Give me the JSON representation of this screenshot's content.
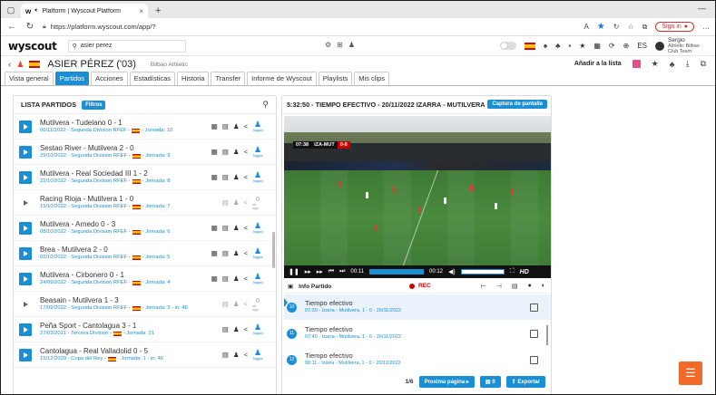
{
  "browser": {
    "tab_favicon": "w",
    "tab_title": "Platform | Wyscout Platform",
    "tab_close": "×",
    "new_tab": "+",
    "url": "https://platform.wyscout.com/app/?",
    "sign_in": "Sign in",
    "minimize": "—"
  },
  "app": {
    "logo": "wyscout",
    "search_value": "asier perez",
    "language": "ES",
    "user_name": "Sergio",
    "user_detail": "Athletic Bilbao Club Team"
  },
  "player": {
    "name": "ASIER PÉREZ ('03)",
    "club": "Bilbao Athletic",
    "add_to_list": "Añadir a la lista"
  },
  "tabs": [
    {
      "label": "Vista general",
      "active": false
    },
    {
      "label": "Partidos",
      "active": true
    },
    {
      "label": "Acciones",
      "active": false
    },
    {
      "label": "Estadísticas",
      "active": false
    },
    {
      "label": "Historia",
      "active": false
    },
    {
      "label": "Transfer",
      "active": false
    },
    {
      "label": "Informe de Wyscout",
      "active": false
    },
    {
      "label": "Playlists",
      "active": false
    },
    {
      "label": "Mis clips",
      "active": false
    }
  ],
  "matches_panel": {
    "title": "LISTA PARTIDOS",
    "filters_label": "Filtros",
    "tagged_label": "Tagged",
    "no_tags_label": "No tags",
    "matches": [
      {
        "title": "Mutilvera - Tudelano 0 - 1",
        "date": "06/11/2022 - Segunda Division RFEF -",
        "round": "- Jornada: 10",
        "tagged": true,
        "active": true
      },
      {
        "title": "Sestao River - Mutilvera 2 - 0",
        "date": "29/10/2022 - Segunda Division RFEF -",
        "round": "- Jornada: 9",
        "tagged": true,
        "active": true
      },
      {
        "title": "Mutilvera - Real Sociedad III 1 - 2",
        "date": "22/10/2022 - Segunda Division RFEF -",
        "round": "- Jornada: 8",
        "tagged": true,
        "active": true
      },
      {
        "title": "Racing Rioja - Mutilvera 1 - 0",
        "date": "15/10/2022 - Segunda Division RFEF -",
        "round": "- Jornada: 7",
        "tagged": false,
        "active": false
      },
      {
        "title": "Mutilvera - Arnedo 0 - 3",
        "date": "08/10/2022 - Segunda Division RFEF -",
        "round": "- Jornada: 6",
        "tagged": true,
        "active": true
      },
      {
        "title": "Brea - Mutilvera 2 - 0",
        "date": "02/10/2022 - Segunda Division RFEF -",
        "round": "- Jornada: 5",
        "tagged": true,
        "active": true
      },
      {
        "title": "Mutilvera - Cirbonero 0 - 1",
        "date": "24/09/2022 - Segunda Division RFEF -",
        "round": "- Jornada: 4",
        "tagged": true,
        "active": true
      },
      {
        "title": "Beasain - Mutilvera 1 - 3",
        "date": "17/09/2022 - Segunda Division RFEF -",
        "round": "- Jornada: 3 - in: 46",
        "tagged": false,
        "active": false
      },
      {
        "title": "Peña Sport - Cantolagua 3 - 1",
        "date": "27/03/2021 - Tercera Division -",
        "round": "- Jornada: 21",
        "tagged": true,
        "active": true
      },
      {
        "title": "Cantolagua - Real Valladolid 0 - 5",
        "date": "15/12/2020 - Copa del Rey -",
        "round": "- Jornada: 1 - in: 46",
        "tagged": true,
        "active": true
      }
    ]
  },
  "video_panel": {
    "title": "5:32:50 - TIEMPO EFECTIVO - 20/11/2022 IZARRA - MUTILVERA",
    "capture_label": "Captura de pantalla",
    "scorebug_time": "07:38",
    "scorebug_teams": "IZA-MUT",
    "scorebug_score": "0-0",
    "current_time": "00:11",
    "clip_time": "00:12",
    "hd_label": "HD",
    "info_label": "Info Partido",
    "rec_label": "REC",
    "clips": [
      {
        "num": "10",
        "name": "Tiempo efectivo",
        "detail": "07:30 - Izarra - Mutilvera, 1 - 0 - 20/11/2022",
        "selected": true
      },
      {
        "num": "11",
        "name": "Tiempo efectivo",
        "detail": "07:40 - Izarra - Mutilvera, 1 - 0 - 20/11/2022",
        "selected": false
      },
      {
        "num": "12",
        "name": "Tiempo efectivo",
        "detail": "08:11 - Izarra - Mutilvera, 1 - 0 - 20/11/2022",
        "selected": false
      }
    ],
    "page_info": "1/6",
    "next_page": "Proxima página ▸",
    "selected_count": "0",
    "export_label": "Exportar"
  },
  "colors": {
    "accent": "#1a8fd6",
    "rec": "#cc0000",
    "chat": "#f26a2a"
  }
}
